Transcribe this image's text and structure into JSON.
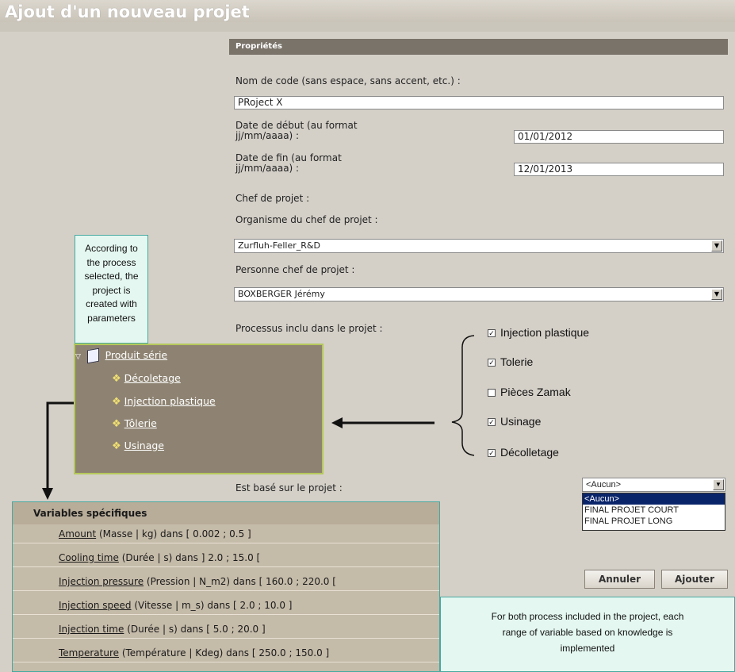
{
  "page_title": "Ajout d'un nouveau projet",
  "properties": {
    "header": "Propriétés",
    "code_label": "Nom de code (sans espace, sans accent, etc.) :",
    "code_value": "PRoject X",
    "start_label_1": "Date de début (au format",
    "start_label_2": "jj/mm/aaaa) :",
    "start_value": "01/01/2012",
    "end_label_1": "Date de fin (au format",
    "end_label_2": "jj/mm/aaaa) :",
    "end_value": "12/01/2013",
    "chief_label": "Chef de projet :",
    "org_label": "Organisme du chef de projet :",
    "org_value": "Zurfluh-Feller_R&D",
    "person_label": "Personne chef de projet :",
    "person_value": "BOXBERGER Jérémy",
    "process_label": "Processus inclu dans le projet :",
    "processes": [
      {
        "label": "Injection plastique",
        "checked": true
      },
      {
        "label": "Tolerie",
        "checked": true
      },
      {
        "label": "Pièces Zamak",
        "checked": false
      },
      {
        "label": "Usinage",
        "checked": true
      },
      {
        "label": "Décolletage",
        "checked": true
      }
    ],
    "based_on_label": "Est basé sur le projet :",
    "based_on_value": "<Aucun>",
    "based_on_options": [
      "<Aucun>",
      "FINAL PROJET COURT",
      "FINAL PROJET LONG"
    ]
  },
  "buttons": {
    "cancel": "Annuler",
    "add": "Ajouter"
  },
  "tree": {
    "root": "Produit série",
    "children": [
      "Décoletage",
      "Injection plastique",
      "Tôlerie",
      "Usinage"
    ]
  },
  "callout_top": {
    "lines": [
      "According to",
      "the process",
      "selected, the",
      "project is",
      "created with",
      "parameters"
    ]
  },
  "callout_bottom": {
    "lines": [
      "For both process included in the project, each",
      "range of variable based on knowledge is",
      "implemented"
    ]
  },
  "variables": {
    "header": "Variables spécifiques",
    "rows": [
      {
        "name": "Amount",
        "desc": " (Masse | kg) dans [ 0.002 ; 0.5 ]"
      },
      {
        "name": "Cooling time",
        "desc": " (Durée | s) dans ] 2.0 ; 15.0 ["
      },
      {
        "name": "Injection pressure",
        "desc": " (Pression | N_m2) dans [ 160.0 ; 220.0 ["
      },
      {
        "name": "Injection speed",
        "desc": " (Vitesse | m_s) dans [ 2.0 ; 10.0 ]"
      },
      {
        "name": "Injection time",
        "desc": " (Durée | s) dans [ 5.0 ; 20.0 ]"
      },
      {
        "name": "Temperature",
        "desc": " (Température | Kdeg) dans [ 250.0 ; 150.0 ]"
      }
    ]
  },
  "colors": {
    "header_bg": "#7a736a",
    "tree_bg": "#8e8372",
    "callout_bg": "#e4f7f0",
    "callout_border": "#46a9a0",
    "tree_border": "#b5c85a"
  }
}
